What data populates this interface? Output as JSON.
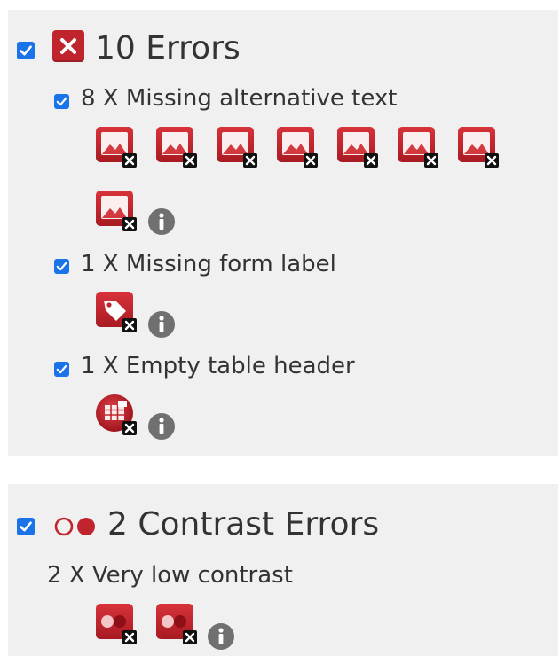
{
  "errors_section": {
    "count_label": "10 Errors",
    "checked": true,
    "groups": [
      {
        "label": "8 X Missing alternative text",
        "checked": true,
        "icon": "missing-image-icon",
        "count": 8
      },
      {
        "label": "1 X Missing form label",
        "checked": true,
        "icon": "tag-icon",
        "count": 1
      },
      {
        "label": "1 X Empty table header",
        "checked": true,
        "icon": "table-icon",
        "count": 1
      }
    ]
  },
  "contrast_section": {
    "count_label": "2 Contrast Errors",
    "checked": true,
    "groups": [
      {
        "label": "2 X Very low contrast",
        "icon": "low-contrast-icon",
        "count": 2
      }
    ]
  },
  "colors": {
    "error_red": "#c0242c",
    "checkbox_blue": "#1a73e8",
    "info_gray": "#707070",
    "panel_bg": "#f0f0f0"
  }
}
